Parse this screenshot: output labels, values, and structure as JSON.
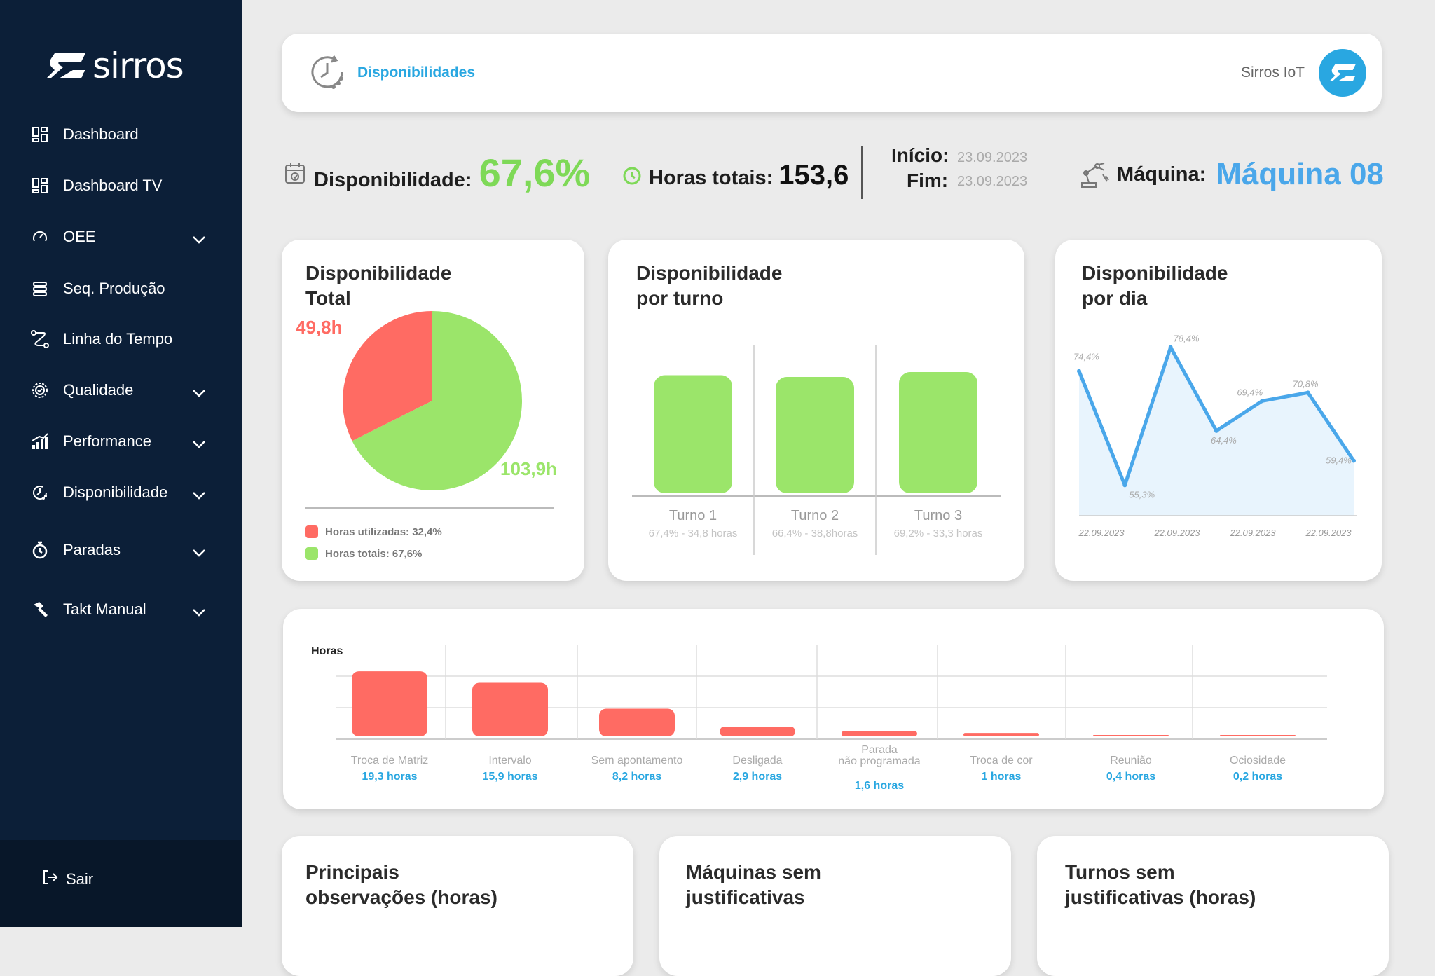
{
  "sidebar": {
    "logo_text": "sirros",
    "items": [
      {
        "label": "Dashboard",
        "icon": "dashboard-icon",
        "has_chevron": false
      },
      {
        "label": "Dashboard TV",
        "icon": "dashboard-icon",
        "has_chevron": false
      },
      {
        "label": "OEE",
        "icon": "gauge-icon",
        "has_chevron": true
      },
      {
        "label": "Seq. Produção",
        "icon": "stack-icon",
        "has_chevron": false
      },
      {
        "label": "Linha do Tempo",
        "icon": "route-icon",
        "has_chevron": false
      },
      {
        "label": "Qualidade",
        "icon": "quality-badge-icon",
        "has_chevron": true
      },
      {
        "label": "Performance",
        "icon": "bar-chart-icon",
        "has_chevron": true
      },
      {
        "label": "Disponibilidade",
        "icon": "clock-refresh-icon",
        "has_chevron": true
      },
      {
        "label": "Paradas",
        "icon": "stopwatch-icon",
        "has_chevron": true
      },
      {
        "label": "Takt Manual",
        "icon": "hammer-icon",
        "has_chevron": true
      }
    ],
    "logout_label": "Sair"
  },
  "header": {
    "title": "Disponibilidades",
    "brand_name": "Sirros IoT"
  },
  "kpis": {
    "availability_label": "Disponibilidade:",
    "availability_value": "67,6%",
    "total_hours_label": "Horas totais:",
    "total_hours_value": "153,6",
    "start_label": "Início:",
    "start_value": "23.09.2023",
    "end_label": "Fim:",
    "end_value": "23.09.2023",
    "machine_label": "Máquina:",
    "machine_value": "Máquina 08"
  },
  "colors": {
    "green": "#9be56a",
    "red": "#ff6b63",
    "blue": "#4aa7ea",
    "navy": "#0c1f38"
  },
  "cards": {
    "total": {
      "title_line1": "Disponibilidade",
      "title_line2": "Total",
      "legend": [
        {
          "label": "Horas utilizadas: 32,4%",
          "color": "#ff6b63"
        },
        {
          "label": "Horas totais: 67,6%",
          "color": "#9be56a"
        }
      ]
    },
    "turno": {
      "title_line1": "Disponibilidade",
      "title_line2": "por turno"
    },
    "dia": {
      "title_line1": "Disponibilidade",
      "title_line2": "por dia"
    },
    "obs": {
      "title_line1": "Principais",
      "title_line2": "observações (horas)"
    },
    "maq": {
      "title_line1": "Máquinas sem",
      "title_line2": "justificativas"
    },
    "turnos": {
      "title_line1": "Turnos sem",
      "title_line2": "justificativas (horas)"
    }
  },
  "chart_data": [
    {
      "type": "pie",
      "slices": [
        {
          "label": "49,8h",
          "value": 49.8,
          "color": "#ff6b63"
        },
        {
          "label": "103,9h",
          "value": 103.9,
          "color": "#9be56a"
        }
      ]
    },
    {
      "type": "bar",
      "categories": [
        "Turno 1",
        "Turno 2",
        "Turno 3"
      ],
      "sublabels": [
        "67,4% - 34,8 horas",
        "66,4% - 38,8horas",
        "69,2% - 33,3 horas"
      ],
      "values": [
        67.4,
        66.4,
        69.2
      ]
    },
    {
      "type": "area",
      "points": [
        {
          "label": "74,4%",
          "value": 74.4
        },
        {
          "label": "55,3%",
          "value": 55.3
        },
        {
          "label": "78,4%",
          "value": 78.4
        },
        {
          "label": "64,4%",
          "value": 64.4
        },
        {
          "label": "69,4%",
          "value": 69.4
        },
        {
          "label": "70,8%",
          "value": 70.8
        },
        {
          "label": "59,4%",
          "value": 59.4
        }
      ],
      "x_ticks": [
        "22.09.2023",
        "22.09.2023",
        "22.09.2023",
        "22.09.2023"
      ]
    },
    {
      "type": "bar",
      "ylabel": "Horas",
      "categories": [
        "Troca de Matriz",
        "Intervalo",
        "Sem apontamento",
        "Desligada",
        "Parada não programada",
        "Troca de cor",
        "Reunião",
        "Ociosidade"
      ],
      "value_labels": [
        "19,3 horas",
        "15,9 horas",
        "8,2 horas",
        "2,9 horas",
        "1,6 horas",
        "1 horas",
        "0,4 horas",
        "0,2 horas"
      ],
      "values": [
        19.3,
        15.9,
        8.2,
        2.9,
        1.6,
        1.0,
        0.4,
        0.2
      ]
    }
  ]
}
